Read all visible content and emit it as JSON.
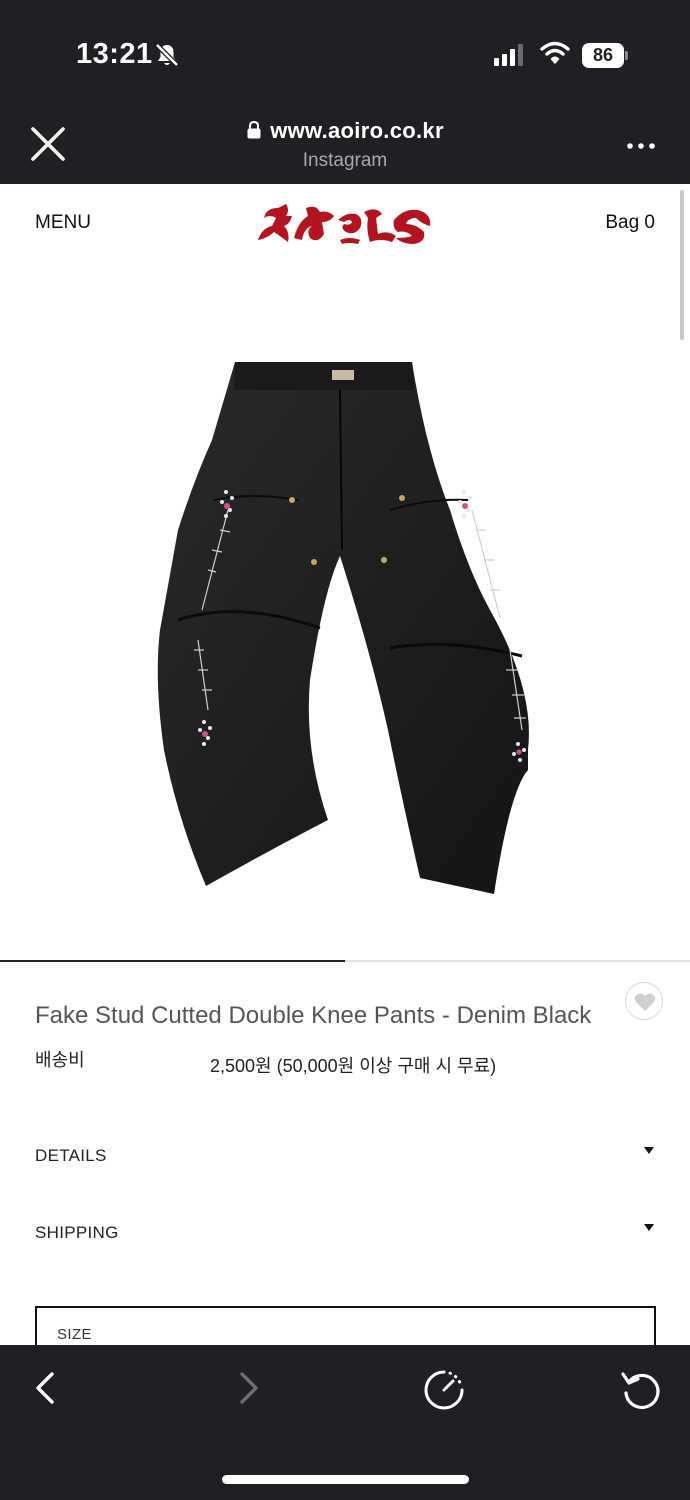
{
  "status_bar": {
    "time": "13:21",
    "battery_level": "86",
    "icons": [
      "bell-slash-icon",
      "cellular-signal-icon",
      "wifi-icon",
      "battery-icon"
    ]
  },
  "browser": {
    "url": "www.aoiro.co.kr",
    "subtitle": "Instagram",
    "icons": [
      "close-icon",
      "lock-icon",
      "more-icon"
    ]
  },
  "site_header": {
    "menu_label": "MENU",
    "bag_label": "Bag 0",
    "logo_icon": "aoiro-logo",
    "brand_color": "#b2151f"
  },
  "product": {
    "image_icon": "double-knee-pants-image",
    "gallery_progress": 0.5,
    "title": "Fake Stud Cutted Double Knee Pants - Denim Black",
    "shipping_label": "배송비",
    "shipping_value": "2,500원 (50,000원 이상 구매 시 무료)",
    "wishlist_icon": "heart-icon"
  },
  "accordions": [
    {
      "label": "DETAILS",
      "icon": "caret-down-icon"
    },
    {
      "label": "SHIPPING",
      "icon": "caret-down-icon"
    }
  ],
  "size_select": {
    "label": "SIZE"
  },
  "toolbar": {
    "icons": [
      "back-icon",
      "forward-icon",
      "speed-icon",
      "reload-icon"
    ]
  }
}
